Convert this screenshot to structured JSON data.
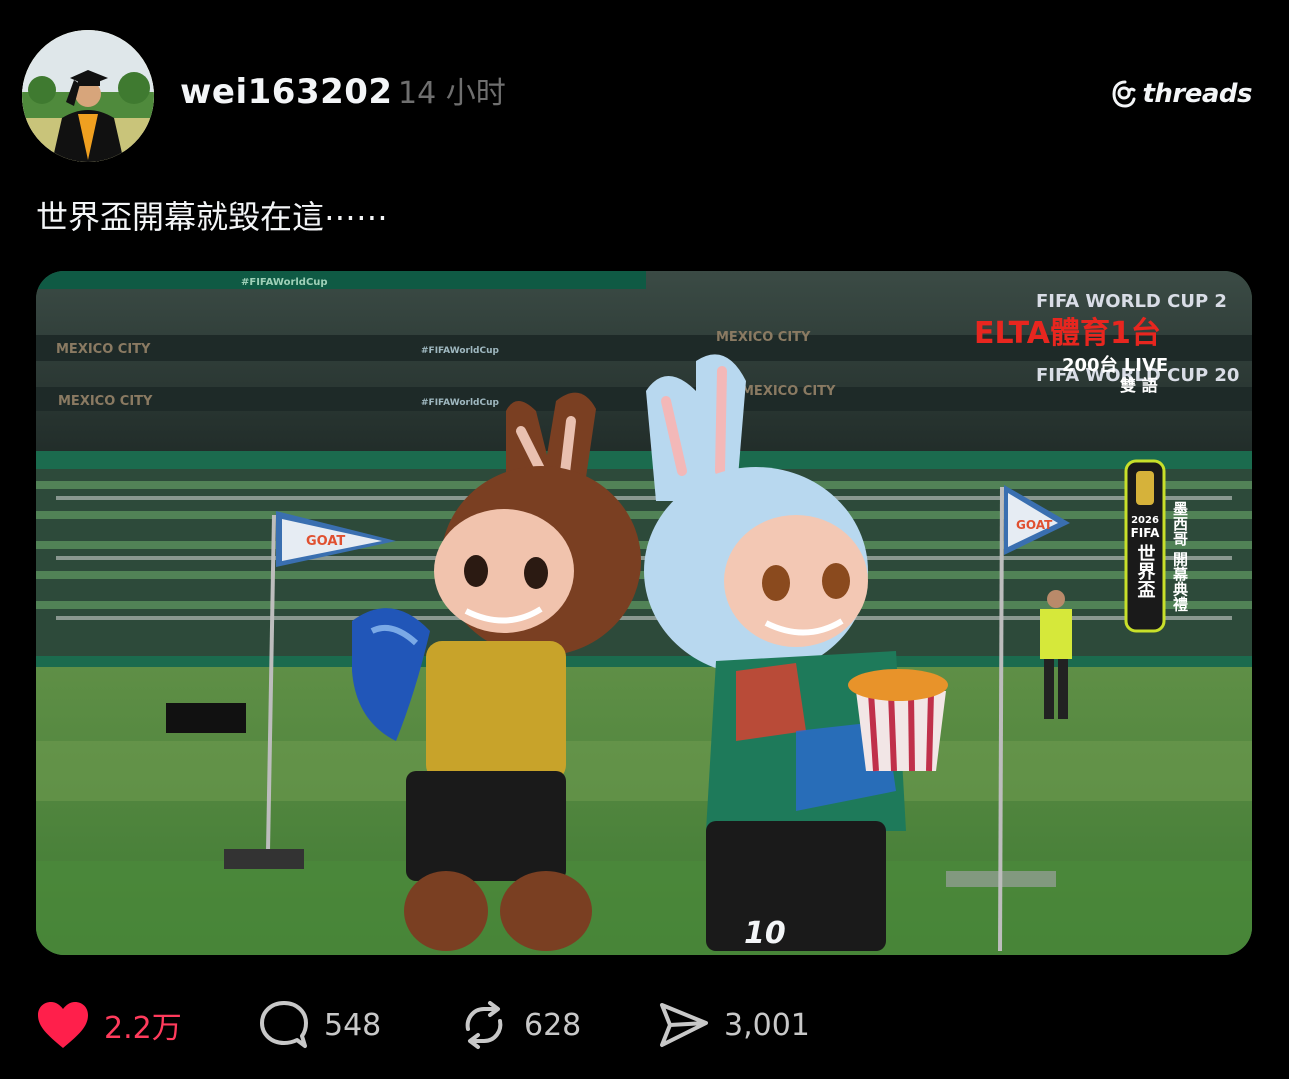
{
  "post": {
    "username": "wei163202",
    "timestamp": "14 小时",
    "caption": "世界盃開幕就毀在這⋯⋯",
    "brand": "threads",
    "avatar_icon": "graduate-avatar"
  },
  "media": {
    "overlay": {
      "channel_logo": "ELTA體育1台",
      "channel_line": "200台 LIVE",
      "language": "雙 語",
      "event_badge_year": "2026",
      "event_badge_org": "FIFA",
      "event_badge_title": "世界盃",
      "event_side_text": "墨西哥 開幕典禮"
    },
    "stadium_text": {
      "banner_top": "#FIFAWorldCup",
      "banner_city_1": "MEXICO CITY",
      "banner_city_2": "MEXICO CITY",
      "banner_hash_1": "#FIFAWorldCup",
      "banner_hash_2": "#FIFAWorldCup",
      "banner_city_3": "MEXICO CITY",
      "banner_city_4": "MEXICO CITY",
      "wc_sign_1": "FIFA WORLD CUP 2",
      "wc_sign_2": "FIFA WORLD CUP 20",
      "flag_left": "GOAT",
      "flag_right": "GOAT",
      "jersey_number": "10"
    }
  },
  "actions": {
    "like_count": "2.2万",
    "reply_count": "548",
    "repost_count": "628",
    "share_count": "3,001"
  },
  "colors": {
    "like": "#ff3b5c",
    "text": "#f3f5f7",
    "muted": "#6f6f6f"
  }
}
